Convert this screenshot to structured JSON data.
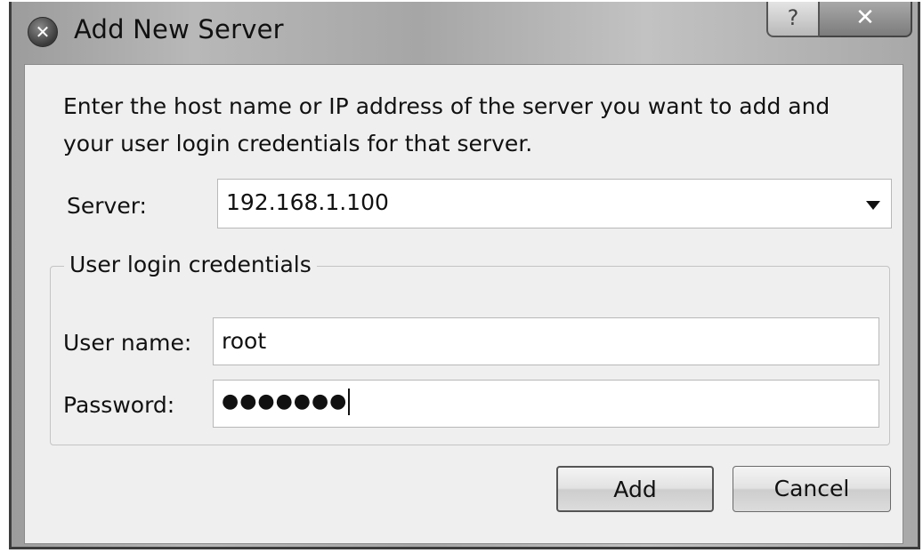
{
  "window": {
    "title": "Add New Server",
    "help_glyph": "?",
    "close_glyph": "✕",
    "icon_glyph": "✕"
  },
  "instructions": "Enter the host name or IP address of the server you want to add and your user login credentials for that server.",
  "server": {
    "label": "Server:",
    "value": "192.168.1.100"
  },
  "credentials": {
    "group_title": "User login credentials",
    "username_label": "User name:",
    "username_value": "root",
    "password_label": "Password:",
    "password_mask": "●●●●●●●"
  },
  "buttons": {
    "add": "Add",
    "cancel": "Cancel"
  }
}
